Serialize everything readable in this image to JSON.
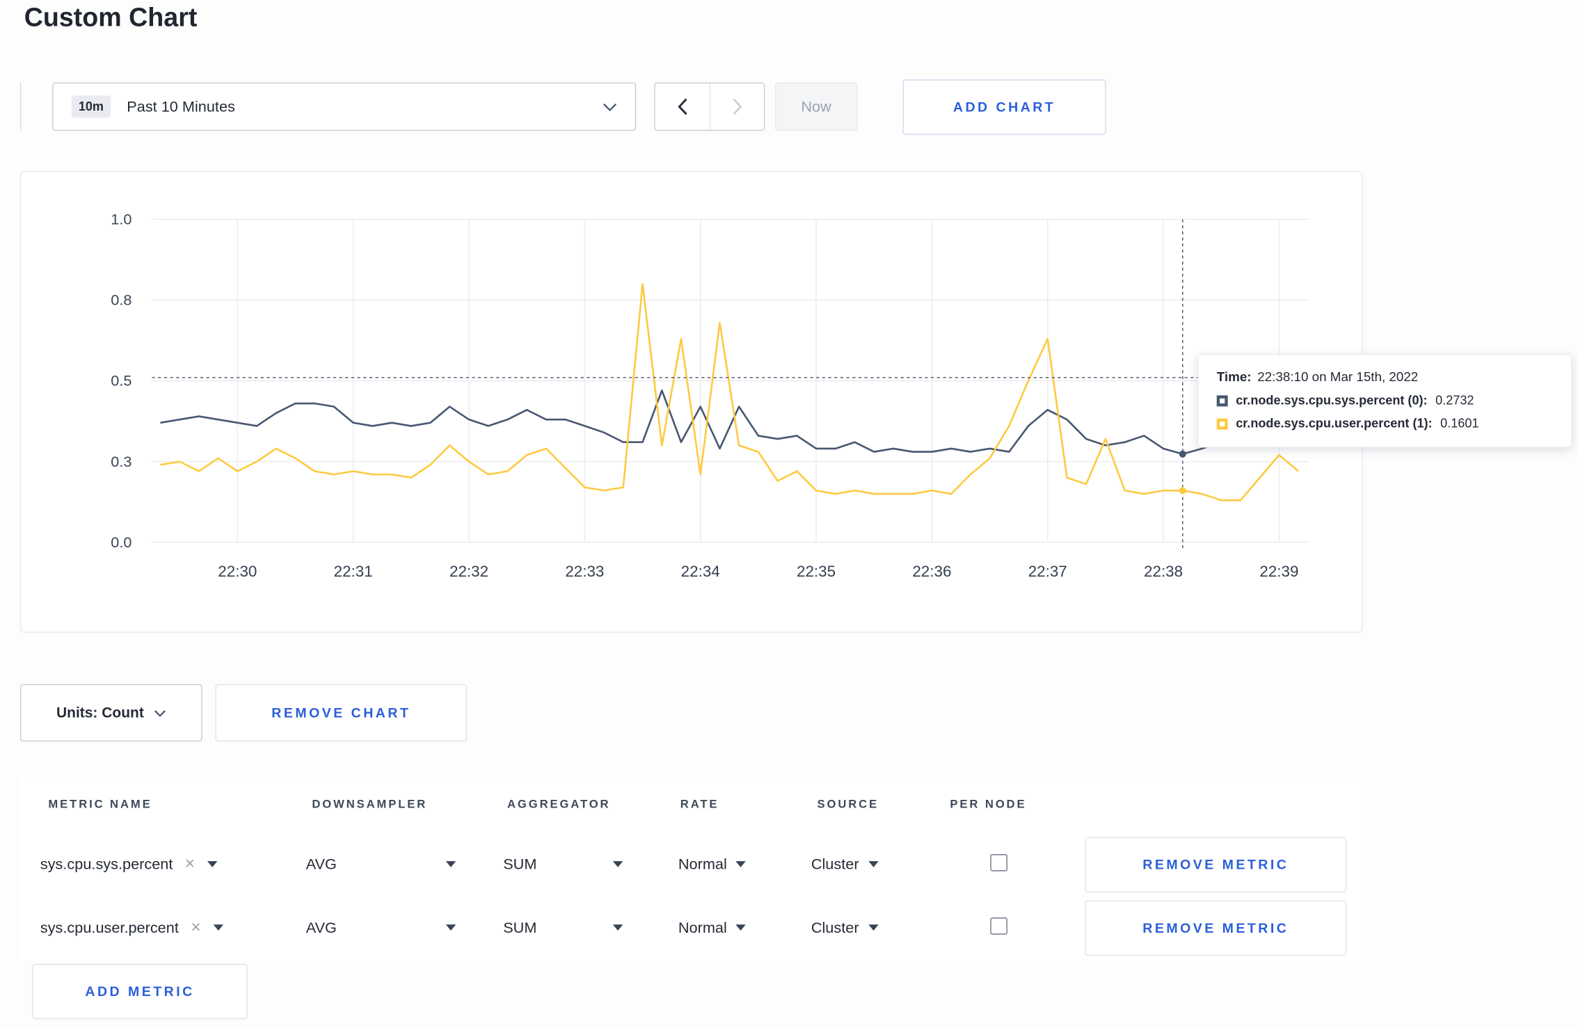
{
  "page": {
    "title": "Custom Chart"
  },
  "colors": {
    "accent_blue": "#2b5fd9"
  },
  "toolbar": {
    "range_badge": "10m",
    "range_label": "Past 10 Minutes",
    "now_label": "Now",
    "add_chart_label": "ADD CHART"
  },
  "tooltip": {
    "time_label": "Time:",
    "time_value": "22:38:10 on Mar 15th, 2022",
    "series": [
      {
        "name": "cr.node.sys.cpu.sys.percent (0):",
        "value": "0.2732"
      },
      {
        "name": "cr.node.sys.cpu.user.percent (1):",
        "value": "0.1601"
      }
    ]
  },
  "units": {
    "label": "Units: Count"
  },
  "chart_actions": {
    "remove_chart_label": "REMOVE CHART"
  },
  "metrics_table": {
    "headers": [
      "METRIC NAME",
      "DOWNSAMPLER",
      "AGGREGATOR",
      "RATE",
      "SOURCE",
      "PER NODE"
    ],
    "rows": [
      {
        "metric": "sys.cpu.sys.percent",
        "downsampler": "AVG",
        "aggregator": "SUM",
        "rate": "Normal",
        "source": "Cluster",
        "per_node_checked": false,
        "remove_label": "REMOVE METRIC"
      },
      {
        "metric": "sys.cpu.user.percent",
        "downsampler": "AVG",
        "aggregator": "SUM",
        "rate": "Normal",
        "source": "Cluster",
        "per_node_checked": false,
        "remove_label": "REMOVE METRIC"
      }
    ],
    "add_metric_label": "ADD METRIC"
  },
  "chart_data": {
    "type": "line",
    "title": "",
    "xlabel": "",
    "ylabel": "",
    "ylim": [
      0,
      1
    ],
    "grid": true,
    "x_start": "22:29:20",
    "x_interval_seconds": 10,
    "x_ticks": [
      "22:30",
      "22:31",
      "22:32",
      "22:33",
      "22:34",
      "22:35",
      "22:36",
      "22:37",
      "22:38",
      "22:39"
    ],
    "y_ticks": {
      "values": [
        0,
        0.25,
        0.5,
        0.75,
        1
      ],
      "labels": [
        "0.0",
        "0.3",
        "0.5",
        "0.8",
        "1.0"
      ]
    },
    "series": [
      {
        "name": "cr.node.sys.cpu.sys.percent",
        "color": "#475770",
        "values": [
          0.37,
          0.38,
          0.39,
          0.38,
          0.37,
          0.36,
          0.4,
          0.43,
          0.43,
          0.42,
          0.37,
          0.36,
          0.37,
          0.36,
          0.37,
          0.42,
          0.38,
          0.36,
          0.38,
          0.41,
          0.38,
          0.38,
          0.36,
          0.34,
          0.31,
          0.31,
          0.47,
          0.31,
          0.42,
          0.29,
          0.42,
          0.33,
          0.32,
          0.33,
          0.29,
          0.29,
          0.31,
          0.28,
          0.29,
          0.28,
          0.28,
          0.29,
          0.28,
          0.29,
          0.28,
          0.36,
          0.41,
          0.38,
          0.32,
          0.3,
          0.31,
          0.33,
          0.29,
          0.2732,
          0.29,
          0.31,
          0.3,
          0.3,
          0.31,
          0.33
        ]
      },
      {
        "name": "cr.node.sys.cpu.user.percent",
        "color": "#fdca40",
        "values": [
          0.24,
          0.25,
          0.22,
          0.26,
          0.22,
          0.25,
          0.29,
          0.26,
          0.22,
          0.21,
          0.22,
          0.21,
          0.21,
          0.2,
          0.24,
          0.3,
          0.25,
          0.21,
          0.22,
          0.27,
          0.29,
          0.23,
          0.17,
          0.16,
          0.17,
          0.8,
          0.3,
          0.63,
          0.21,
          0.68,
          0.3,
          0.28,
          0.19,
          0.22,
          0.16,
          0.15,
          0.16,
          0.15,
          0.15,
          0.15,
          0.16,
          0.15,
          0.21,
          0.26,
          0.36,
          0.5,
          0.63,
          0.2,
          0.18,
          0.32,
          0.16,
          0.15,
          0.16,
          0.1601,
          0.15,
          0.13,
          0.13,
          0.2,
          0.27,
          0.22
        ]
      }
    ],
    "crosshair": {
      "index": 53,
      "y_value": 0.51,
      "time": "22:38:10"
    },
    "legend_position": "tooltip"
  }
}
